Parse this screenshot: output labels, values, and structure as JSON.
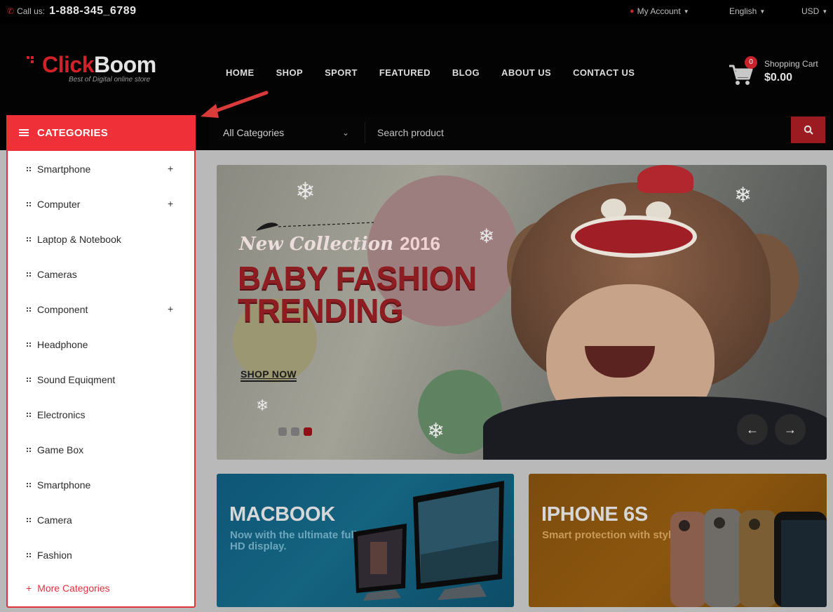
{
  "topbar": {
    "call_label": "Call us:",
    "phone": "1-888-345_6789",
    "account": "My Account",
    "language": "English",
    "currency": "USD"
  },
  "brand": {
    "name_part1": "Click",
    "name_part2": "Boom",
    "tagline": "Best of Digital online store"
  },
  "nav": [
    "HOME",
    "SHOP",
    "SPORT",
    "FEATURED",
    "BLOG",
    "ABOUT US",
    "CONTACT US"
  ],
  "cart": {
    "count": "0",
    "label": "Shopping Cart",
    "total": "$0.00"
  },
  "search": {
    "category": "All Categories",
    "placeholder": "Search product"
  },
  "categories": {
    "title": "CATEGORIES",
    "items": [
      {
        "label": "Smartphone",
        "has_sub": true
      },
      {
        "label": "Computer",
        "has_sub": true
      },
      {
        "label": "Laptop & Notebook",
        "has_sub": false
      },
      {
        "label": "Cameras",
        "has_sub": false
      },
      {
        "label": "Component",
        "has_sub": true
      },
      {
        "label": "Headphone",
        "has_sub": false
      },
      {
        "label": "Sound Equiqment",
        "has_sub": false
      },
      {
        "label": "Electronics",
        "has_sub": false
      },
      {
        "label": "Game Box",
        "has_sub": false
      },
      {
        "label": "Smartphone",
        "has_sub": false
      },
      {
        "label": "Camera",
        "has_sub": false
      },
      {
        "label": "Fashion",
        "has_sub": false
      }
    ],
    "more": "More Categories"
  },
  "banner": {
    "subtitle": "New Collection",
    "year": "2016",
    "headline_line1": "BABY FASHION",
    "headline_line2": "TRENDING",
    "cta": "SHOP NOW",
    "slide_count": 3,
    "active_slide": 3
  },
  "promos": [
    {
      "title": "MACBOOK",
      "subtitle": "Now with the ultimate full HD display."
    },
    {
      "title": "IPHONE 6S",
      "subtitle": "Smart protection with style."
    }
  ],
  "colors": {
    "accent": "#ef3038",
    "overlay_dark": "#030303",
    "mac_blue": "#14637f",
    "iphone_orange": "#8b560f"
  }
}
